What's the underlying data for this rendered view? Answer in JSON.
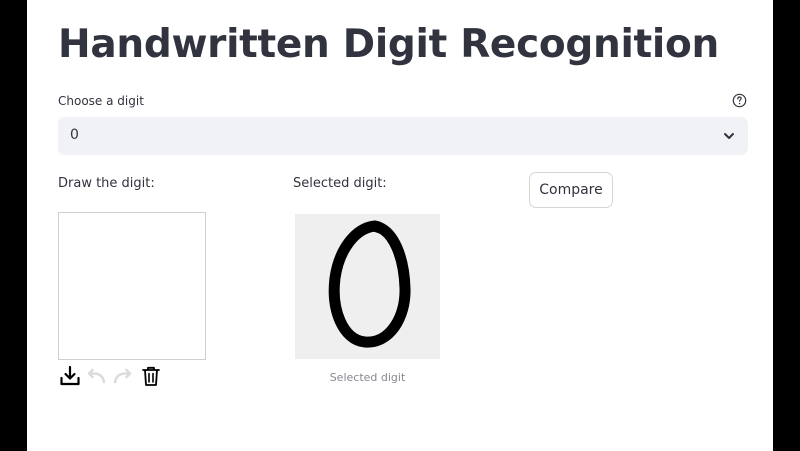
{
  "app": {
    "title": "Handwritten Digit Recognition",
    "accent_text_color": "#31333f",
    "background_color": "#ffffff"
  },
  "digit_select": {
    "label": "Choose a digit",
    "selected_value": "0",
    "help_icon": "question-circle-icon",
    "dropdown_icon": "chevron-down-icon"
  },
  "draw_panel": {
    "label": "Draw the digit:",
    "toolbar": [
      "download-icon",
      "undo-icon",
      "redo-icon",
      "trash-icon"
    ]
  },
  "selected_panel": {
    "label": "Selected digit:",
    "caption": "Selected digit",
    "image_content": "0"
  },
  "actions": {
    "compare_label": "Compare"
  }
}
